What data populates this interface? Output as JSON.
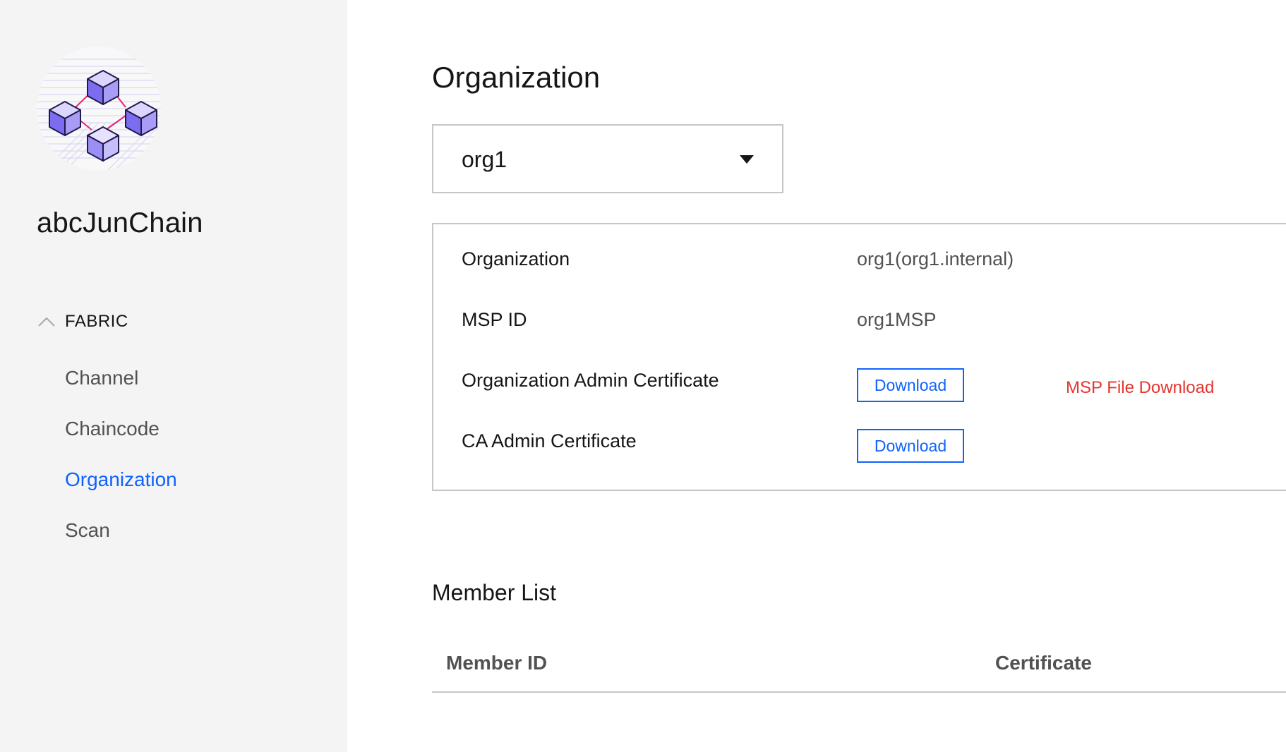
{
  "sidebar": {
    "app_name": "abcJunChain",
    "group": {
      "label": "FABRIC",
      "expanded": true
    },
    "items": [
      {
        "label": "Channel",
        "active": false
      },
      {
        "label": "Chaincode",
        "active": false
      },
      {
        "label": "Organization",
        "active": true
      },
      {
        "label": "Scan",
        "active": false
      }
    ]
  },
  "main": {
    "title": "Organization",
    "org_select": {
      "value": "org1"
    },
    "details": {
      "org_label": "Organization",
      "org_value": "org1(org1.internal)",
      "msp_label": "MSP ID",
      "msp_value": "org1MSP",
      "admin_cert_label": "Organization Admin Certificate",
      "admin_cert_button": "Download",
      "msp_file_link": "MSP File Download",
      "ca_cert_label": "CA Admin Certificate",
      "ca_cert_button": "Download"
    },
    "member_list": {
      "title": "Member List",
      "columns": [
        "Member ID",
        "Certificate"
      ],
      "rows": []
    }
  },
  "colors": {
    "accent": "#0f62fe",
    "link_red": "#e5352e",
    "sidebar_bg": "#f4f4f4",
    "border": "#c6c6c6"
  },
  "icons": {
    "logo": "blockchain-cubes-logo",
    "group_toggle": "chevron-up-icon",
    "select_caret": "caret-down-icon"
  }
}
